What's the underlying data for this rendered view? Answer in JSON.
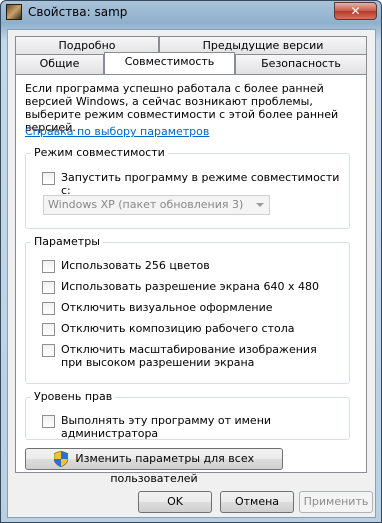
{
  "window": {
    "title": "Свойства: samp",
    "close_glyph": "✕"
  },
  "tabs_row1": [
    {
      "label": "Подробно"
    },
    {
      "label": "Предыдущие версии"
    }
  ],
  "tabs_row2": [
    {
      "label": "Общие"
    },
    {
      "label": "Совместимость",
      "active": true
    },
    {
      "label": "Безопасность"
    }
  ],
  "intro_text": "Если программа успешно работала с более ранней версией Windows, а сейчас возникают проблемы, выберите режим совместимости с этой более ранней версией.",
  "help_link": "Справка по выбору параметров",
  "compat_group": {
    "title": "Режим совместимости",
    "checkbox_label": "Запустить программу в режиме совместимости с:",
    "select_value": "Windows XP (пакет обновления 3)"
  },
  "params_group": {
    "title": "Параметры",
    "items": [
      "Использовать 256 цветов",
      "Использовать разрешение экрана 640 x 480",
      "Отключить визуальное оформление",
      "Отключить композицию рабочего стола",
      "Отключить масштабирование изображения при высоком разрешении экрана"
    ]
  },
  "rights_group": {
    "title": "Уровень прав",
    "checkbox_label": "Выполнять эту программу от имени администратора"
  },
  "all_users_button": "Изменить параметры для всех пользователей",
  "footer": {
    "ok": "OK",
    "cancel": "Отмена",
    "apply": "Применить"
  }
}
